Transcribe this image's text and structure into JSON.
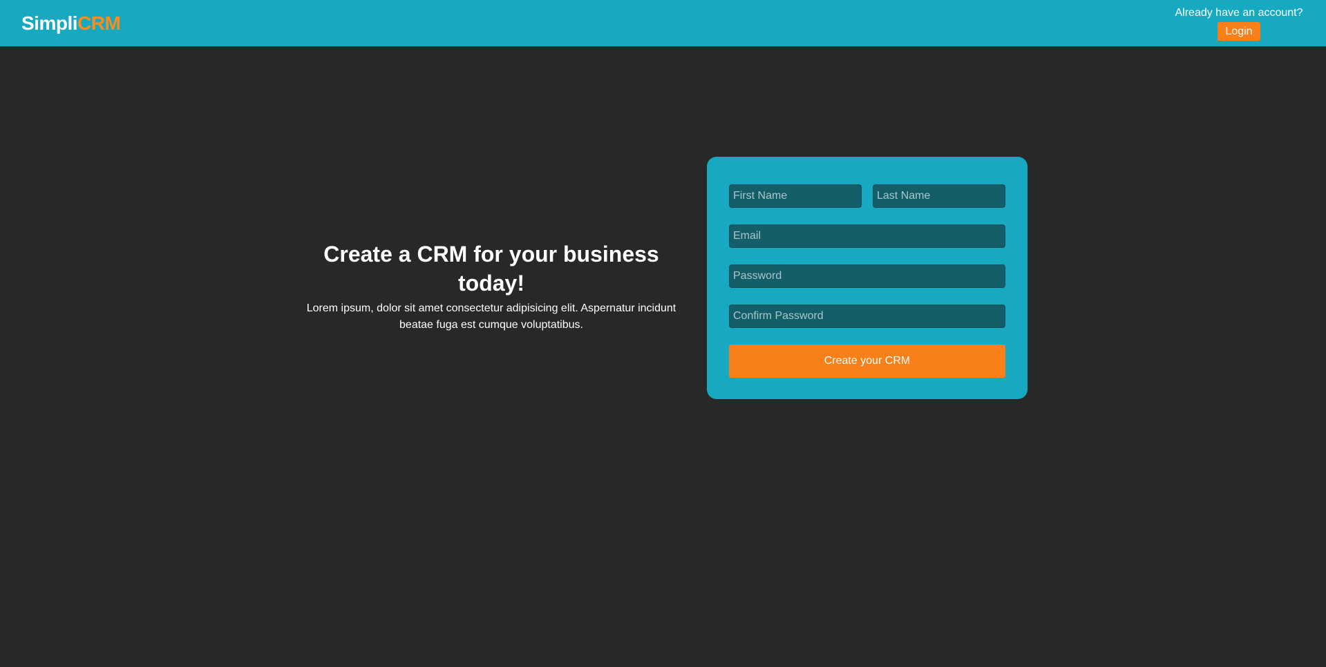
{
  "header": {
    "brand_part1": "Simpli",
    "brand_part2": "CRM",
    "account_prompt": "Already have an account?",
    "login_label": "Login"
  },
  "hero": {
    "title": "Create a CRM for your business today!",
    "subtitle": "Lorem ipsum, dolor sit amet consectetur adipisicing elit. Aspernatur incidunt beatae fuga est cumque voluptatibus."
  },
  "form": {
    "first_name_placeholder": "First Name",
    "last_name_placeholder": "Last Name",
    "email_placeholder": "Email",
    "password_placeholder": "Password",
    "confirm_password_placeholder": "Confirm Password",
    "submit_label": "Create your CRM"
  },
  "colors": {
    "header_bg": "#16a9c1",
    "page_bg": "#282828",
    "accent": "#f98019",
    "input_bg": "#135e69"
  }
}
